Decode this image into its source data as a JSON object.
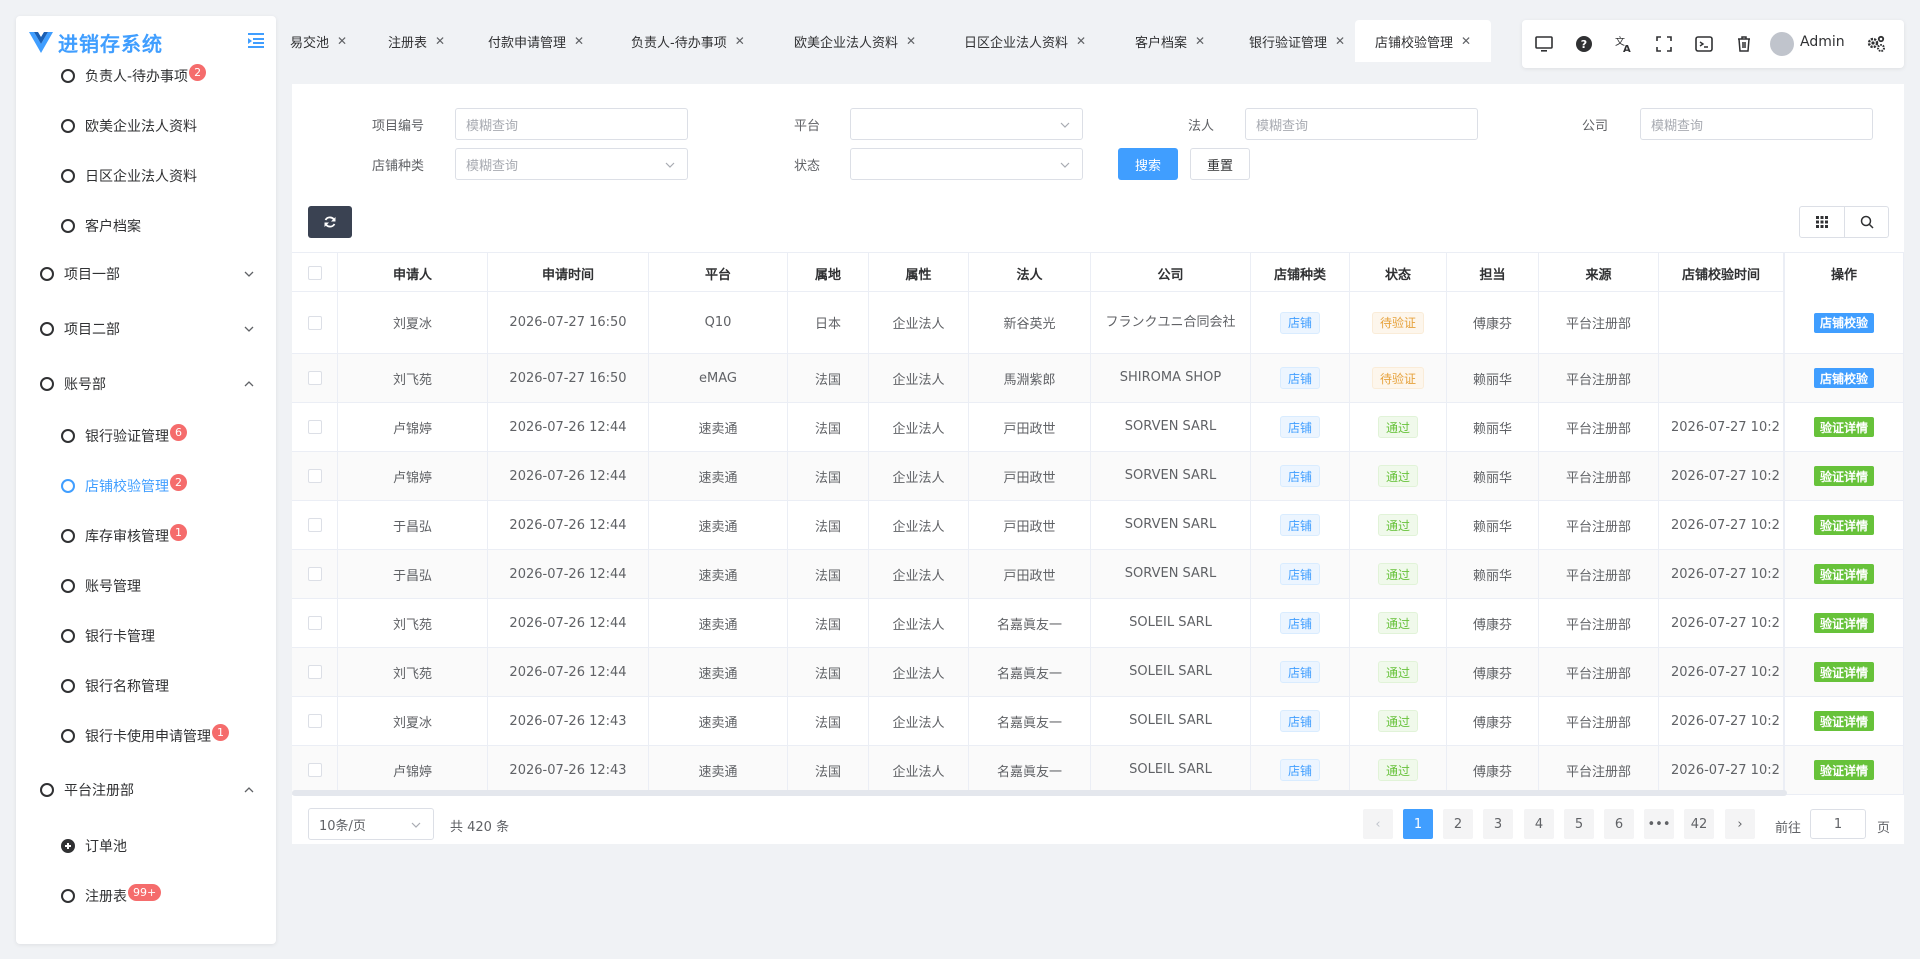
{
  "app": {
    "title": "进销存系统"
  },
  "sidebar": {
    "items": [
      {
        "label": "负责人-待办事项",
        "badge": "2",
        "level": "sub"
      },
      {
        "label": "欧美企业法人资料",
        "badge": "",
        "level": "sub"
      },
      {
        "label": "日区企业法人资料",
        "badge": "",
        "level": "sub"
      },
      {
        "label": "客户档案",
        "badge": "",
        "level": "sub"
      },
      {
        "label": "项目一部",
        "badge": "",
        "level": "top",
        "expanded": false
      },
      {
        "label": "项目二部",
        "badge": "",
        "level": "top",
        "expanded": false
      },
      {
        "label": "账号部",
        "badge": "",
        "level": "top",
        "expanded": true
      },
      {
        "label": "银行验证管理",
        "badge": "6",
        "level": "sub"
      },
      {
        "label": "店铺校验管理",
        "badge": "2",
        "level": "sub",
        "active": true
      },
      {
        "label": "库存审核管理",
        "badge": "1",
        "level": "sub"
      },
      {
        "label": "账号管理",
        "badge": "",
        "level": "sub"
      },
      {
        "label": "银行卡管理",
        "badge": "",
        "level": "sub"
      },
      {
        "label": "银行名称管理",
        "badge": "",
        "level": "sub"
      },
      {
        "label": "银行卡使用申请管理",
        "badge": "1",
        "level": "sub"
      },
      {
        "label": "平台注册部",
        "badge": "",
        "level": "top",
        "expanded": true
      },
      {
        "label": "订单池",
        "badge": "",
        "level": "sub",
        "icon": "plus-circle-icon"
      },
      {
        "label": "注册表",
        "badge": "99+",
        "level": "sub"
      }
    ]
  },
  "tabs": [
    {
      "label": "易交池"
    },
    {
      "label": "注册表"
    },
    {
      "label": "付款申请管理"
    },
    {
      "label": "负责人-待办事项"
    },
    {
      "label": "欧美企业法人资料"
    },
    {
      "label": "日区企业法人资料"
    },
    {
      "label": "客户档案"
    },
    {
      "label": "银行验证管理"
    },
    {
      "label": "店铺校验管理",
      "active": true
    }
  ],
  "toolbar": {
    "icons": [
      "monitor-icon",
      "help-icon",
      "translate-icon",
      "fullscreen-icon",
      "terminal-icon",
      "trash-icon",
      "settings-icon"
    ],
    "user": "Admin"
  },
  "search": {
    "project_no_label": "项目编号",
    "project_no_placeholder": "模糊查询",
    "platform_label": "平台",
    "legal_person_label": "法人",
    "legal_person_placeholder": "模糊查询",
    "company_label": "公司",
    "company_placeholder": "模糊查询",
    "shop_type_label": "店铺种类",
    "shop_type_placeholder": "模糊查询",
    "status_label": "状态",
    "search_button": "搜索",
    "reset_button": "重置"
  },
  "table": {
    "columns": [
      "申请人",
      "申请时间",
      "平台",
      "属地",
      "属性",
      "法人",
      "公司",
      "店铺种类",
      "状态",
      "担当",
      "来源",
      "店铺校验时间",
      "操作"
    ],
    "rows": [
      {
        "applicant": "刘夏冰",
        "time": "2026-07-27 16:50",
        "platform": "Q10",
        "region": "日本",
        "attr": "企业法人",
        "legal": "新谷英光",
        "company": "フランクユニ合同会社",
        "shop_type": "店铺",
        "status": "待验证",
        "status_color": "orange",
        "owner": "傅康芬",
        "source": "平台注册部",
        "verify_time": "",
        "action": "店铺校验",
        "action_color": "blue"
      },
      {
        "applicant": "刘飞苑",
        "time": "2026-07-27 16:50",
        "platform": "eMAG",
        "region": "法国",
        "attr": "企业法人",
        "legal": "馬淵紫郎",
        "company": "SHIROMA SHOP",
        "shop_type": "店铺",
        "status": "待验证",
        "status_color": "orange",
        "owner": "赖丽华",
        "source": "平台注册部",
        "verify_time": "",
        "action": "店铺校验",
        "action_color": "blue"
      },
      {
        "applicant": "卢锦婷",
        "time": "2026-07-26 12:44",
        "platform": "速卖通",
        "region": "法国",
        "attr": "企业法人",
        "legal": "戸田政世",
        "company": "SORVEN SARL",
        "shop_type": "店铺",
        "status": "通过",
        "status_color": "green",
        "owner": "赖丽华",
        "source": "平台注册部",
        "verify_time": "2026-07-27 10:2",
        "action": "验证详情",
        "action_color": "green"
      },
      {
        "applicant": "卢锦婷",
        "time": "2026-07-26 12:44",
        "platform": "速卖通",
        "region": "法国",
        "attr": "企业法人",
        "legal": "戸田政世",
        "company": "SORVEN SARL",
        "shop_type": "店铺",
        "status": "通过",
        "status_color": "green",
        "owner": "赖丽华",
        "source": "平台注册部",
        "verify_time": "2026-07-27 10:2",
        "action": "验证详情",
        "action_color": "green"
      },
      {
        "applicant": "于昌弘",
        "time": "2026-07-26 12:44",
        "platform": "速卖通",
        "region": "法国",
        "attr": "企业法人",
        "legal": "戸田政世",
        "company": "SORVEN SARL",
        "shop_type": "店铺",
        "status": "通过",
        "status_color": "green",
        "owner": "赖丽华",
        "source": "平台注册部",
        "verify_time": "2026-07-27 10:2",
        "action": "验证详情",
        "action_color": "green"
      },
      {
        "applicant": "于昌弘",
        "time": "2026-07-26 12:44",
        "platform": "速卖通",
        "region": "法国",
        "attr": "企业法人",
        "legal": "戸田政世",
        "company": "SORVEN SARL",
        "shop_type": "店铺",
        "status": "通过",
        "status_color": "green",
        "owner": "赖丽华",
        "source": "平台注册部",
        "verify_time": "2026-07-27 10:2",
        "action": "验证详情",
        "action_color": "green"
      },
      {
        "applicant": "刘飞苑",
        "time": "2026-07-26 12:44",
        "platform": "速卖通",
        "region": "法国",
        "attr": "企业法人",
        "legal": "名嘉眞友一",
        "company": "SOLEIL SARL",
        "shop_type": "店铺",
        "status": "通过",
        "status_color": "green",
        "owner": "傅康芬",
        "source": "平台注册部",
        "verify_time": "2026-07-27 10:2",
        "action": "验证详情",
        "action_color": "green"
      },
      {
        "applicant": "刘飞苑",
        "time": "2026-07-26 12:44",
        "platform": "速卖通",
        "region": "法国",
        "attr": "企业法人",
        "legal": "名嘉眞友一",
        "company": "SOLEIL SARL",
        "shop_type": "店铺",
        "status": "通过",
        "status_color": "green",
        "owner": "傅康芬",
        "source": "平台注册部",
        "verify_time": "2026-07-27 10:2",
        "action": "验证详情",
        "action_color": "green"
      },
      {
        "applicant": "刘夏冰",
        "time": "2026-07-26 12:43",
        "platform": "速卖通",
        "region": "法国",
        "attr": "企业法人",
        "legal": "名嘉眞友一",
        "company": "SOLEIL SARL",
        "shop_type": "店铺",
        "status": "通过",
        "status_color": "green",
        "owner": "傅康芬",
        "source": "平台注册部",
        "verify_time": "2026-07-27 10:2",
        "action": "验证详情",
        "action_color": "green"
      },
      {
        "applicant": "卢锦婷",
        "time": "2026-07-26 12:43",
        "platform": "速卖通",
        "region": "法国",
        "attr": "企业法人",
        "legal": "名嘉眞友一",
        "company": "SOLEIL SARL",
        "shop_type": "店铺",
        "status": "通过",
        "status_color": "green",
        "owner": "傅康芬",
        "source": "平台注册部",
        "verify_time": "2026-07-27 10:2",
        "action": "验证详情",
        "action_color": "green"
      }
    ]
  },
  "pagination": {
    "page_size": "10条/页",
    "total": "共 420 条",
    "pages": [
      "1",
      "2",
      "3",
      "4",
      "5",
      "6",
      "•••",
      "42"
    ],
    "current": "1",
    "goto_prefix": "前往",
    "goto_value": "1",
    "goto_suffix": "页"
  },
  "colors": {
    "primary": "#409eff",
    "success": "#67c23a",
    "warning": "#e6a23c",
    "danger": "#f56c6c"
  }
}
